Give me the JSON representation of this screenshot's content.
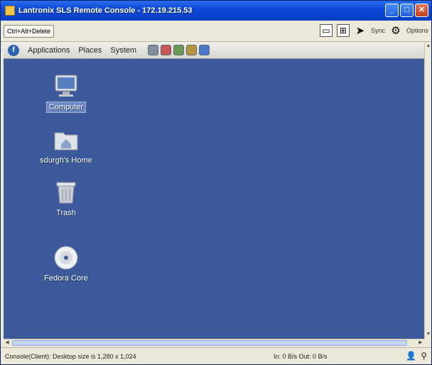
{
  "window": {
    "title": "Lantronix SLS Remote Console - 172.19.215.53",
    "minimize_glyph": "_",
    "maximize_glyph": "□",
    "close_glyph": "✕"
  },
  "toolbar": {
    "cad_label": "Ctrl+Alt+Delete",
    "sync_label": "Sync",
    "options_label": "Options",
    "icons": [
      "screenshot-icon",
      "fit-window-icon",
      "mouse-pointer-icon",
      "settings-icon"
    ]
  },
  "panel": {
    "applications": "Applications",
    "places": "Places",
    "system": "System"
  },
  "desktop": {
    "icons": [
      {
        "label": "Computer",
        "icon": "computer-icon",
        "selected": true
      },
      {
        "label": "sdurgh's Home",
        "icon": "home-folder-icon",
        "selected": false
      },
      {
        "label": "Trash",
        "icon": "trash-icon",
        "selected": false
      },
      {
        "label": "Fedora Core",
        "icon": "cd-disc-icon",
        "selected": false
      }
    ],
    "background_color": "#3c5a9b"
  },
  "statusbar": {
    "left_text": "Console(Client): Desktop size is 1,280 x 1,024",
    "mid_text": "In: 0 B/s  Out: 0 B/s"
  }
}
